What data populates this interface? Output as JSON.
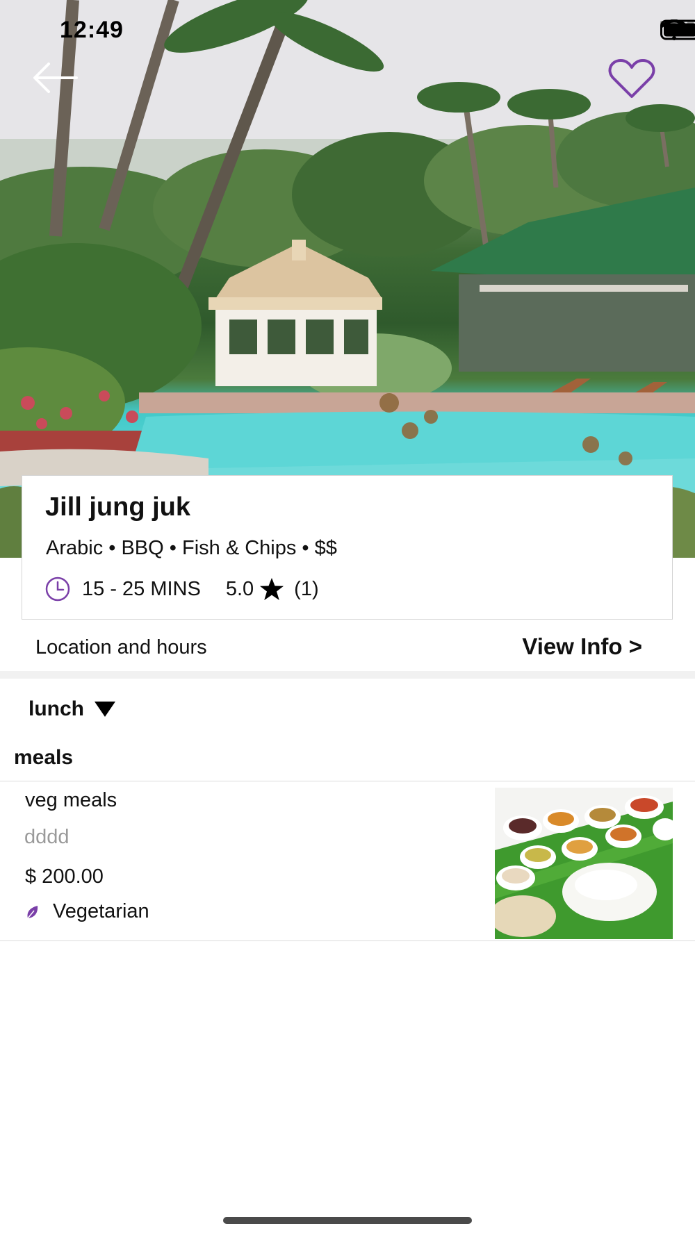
{
  "status_bar": {
    "time": "12:49",
    "icons": [
      "signal-dots-icon",
      "wifi-icon",
      "battery-icon"
    ]
  },
  "header": {
    "back_icon": "back-arrow-icon",
    "favorite_icon": "heart-outline-icon",
    "favorite_color": "#7a3fa8"
  },
  "restaurant": {
    "name": "Jill jung juk",
    "cuisines": "Arabic • BBQ • Fish & Chips • $$",
    "eta": "15 - 25 MINS",
    "rating": "5.0",
    "reviews": "(1)"
  },
  "location": {
    "label": "Location and hours",
    "action": "View Info >"
  },
  "menu": {
    "selected": "lunch",
    "category": "meals",
    "items": [
      {
        "name": "veg meals",
        "description": "dddd",
        "price": "$ 200.00",
        "tag": "Vegetarian"
      }
    ]
  },
  "colors": {
    "accent": "#7a3fa8",
    "muted_text": "#9a9a9a",
    "divider": "#dcdcdc"
  }
}
